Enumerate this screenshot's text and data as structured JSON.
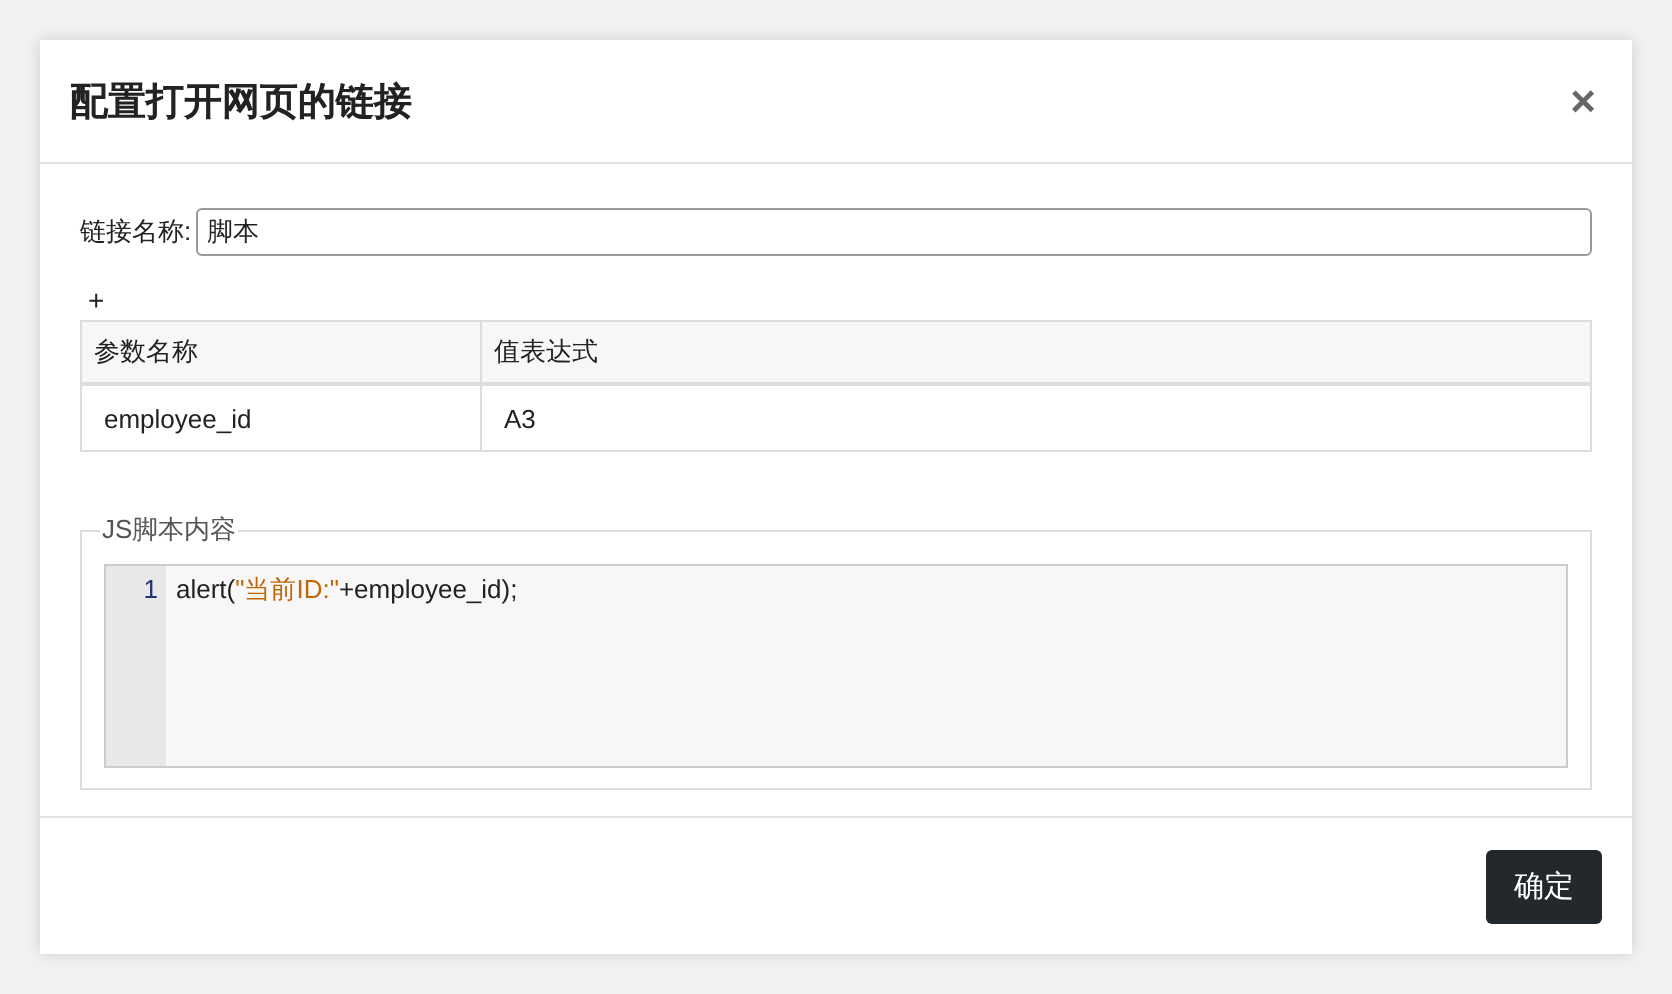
{
  "dialog": {
    "title": "配置打开网页的链接",
    "close": "×"
  },
  "link_name": {
    "label": "链接名称:",
    "value": "脚本"
  },
  "add_button": "+",
  "params_table": {
    "columns": [
      "参数名称",
      "值表达式"
    ],
    "rows": [
      [
        "employee_id",
        "A3"
      ]
    ]
  },
  "script": {
    "legend": "JS脚本内容",
    "lines": [
      {
        "number": "1",
        "tokens": [
          {
            "kind": "plain",
            "text": "alert("
          },
          {
            "kind": "string",
            "text": "\"当前ID:\""
          },
          {
            "kind": "plain",
            "text": "+employee_id);"
          }
        ]
      }
    ]
  },
  "footer": {
    "confirm": "确定"
  }
}
